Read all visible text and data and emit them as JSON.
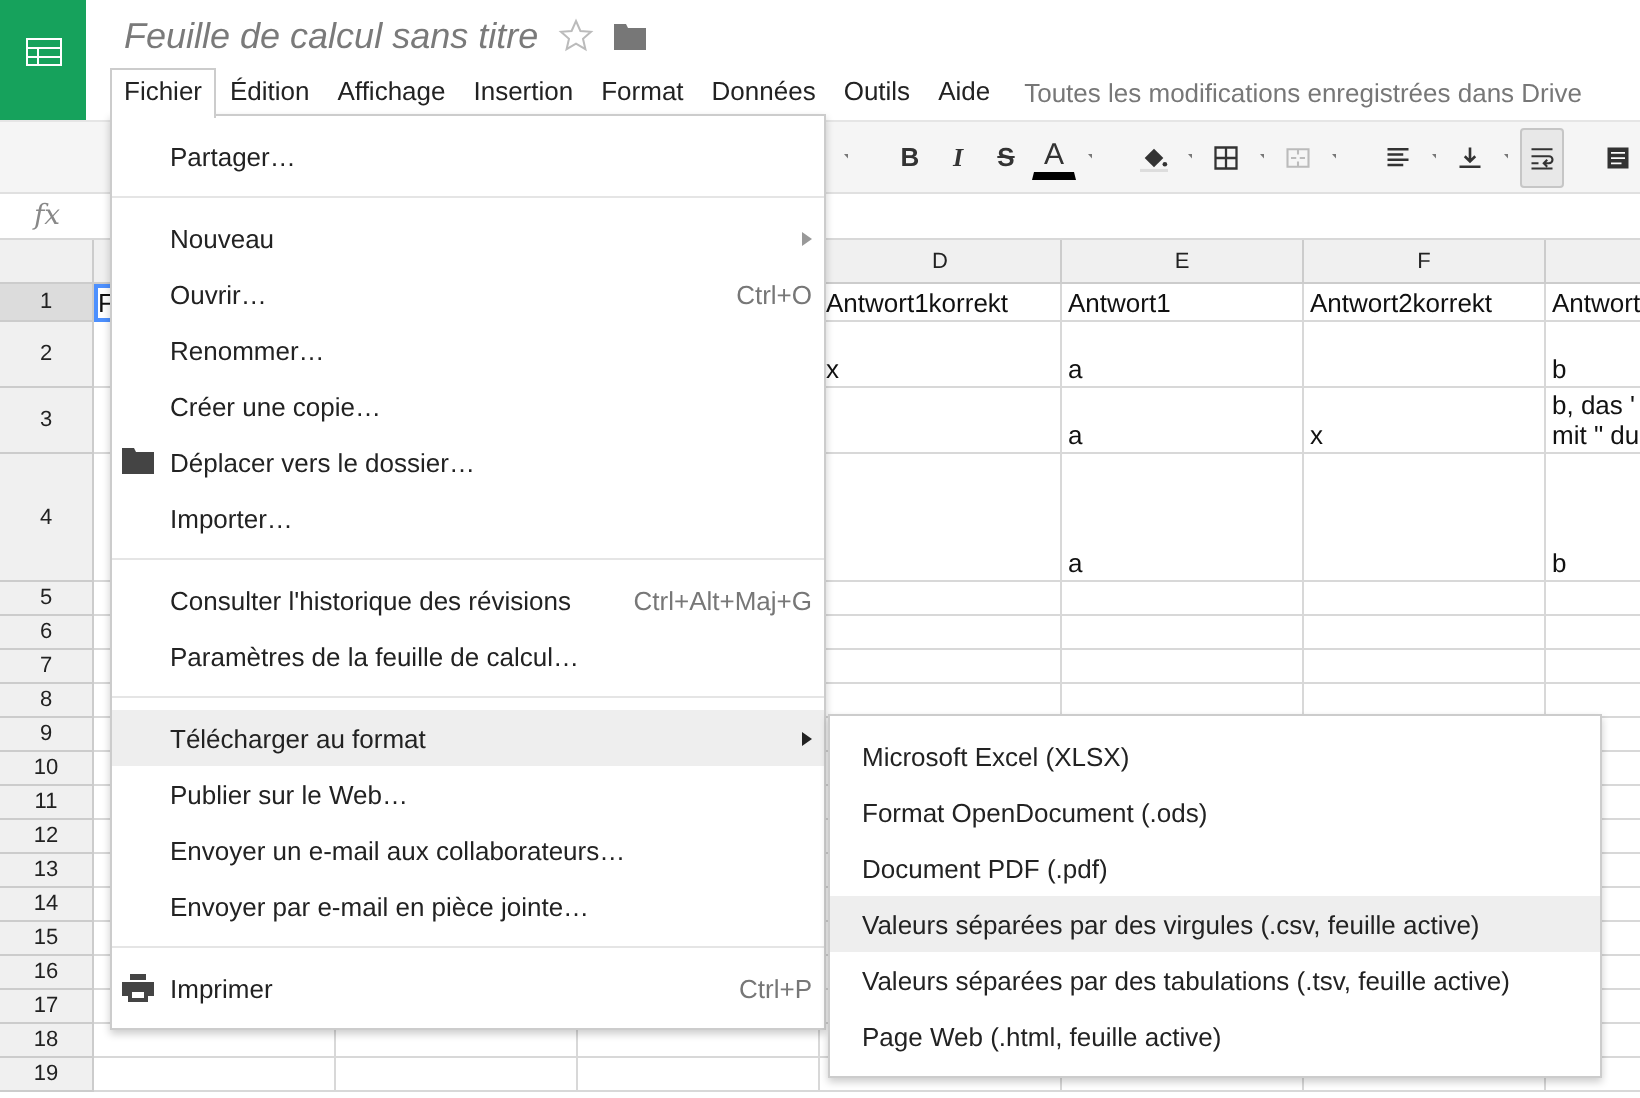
{
  "document": {
    "title": "Feuille de calcul sans titre",
    "starred": false
  },
  "menubar": {
    "items": [
      {
        "label": "Fichier",
        "selected": true
      },
      {
        "label": "Édition",
        "selected": false
      },
      {
        "label": "Affichage",
        "selected": false
      },
      {
        "label": "Insertion",
        "selected": false
      },
      {
        "label": "Format",
        "selected": false
      },
      {
        "label": "Données",
        "selected": false
      },
      {
        "label": "Outils",
        "selected": false
      },
      {
        "label": "Aide",
        "selected": false
      }
    ],
    "status": "Toutes les modifications enregistrées dans Drive"
  },
  "toolbar": [
    {
      "kind": "caret"
    },
    {
      "kind": "separator"
    },
    {
      "kind": "bold",
      "label": "B"
    },
    {
      "kind": "italic",
      "label": "I"
    },
    {
      "kind": "strike",
      "label": "S"
    },
    {
      "kind": "textcolor",
      "label": "A"
    },
    {
      "kind": "caret"
    },
    {
      "kind": "separator"
    },
    {
      "kind": "fill"
    },
    {
      "kind": "caret"
    },
    {
      "kind": "borders"
    },
    {
      "kind": "caret"
    },
    {
      "kind": "merge",
      "disabled": true
    },
    {
      "kind": "caret"
    },
    {
      "kind": "separator"
    },
    {
      "kind": "align"
    },
    {
      "kind": "caret"
    },
    {
      "kind": "valign"
    },
    {
      "kind": "caret"
    },
    {
      "kind": "wrap",
      "selected": true
    },
    {
      "kind": "separator"
    },
    {
      "kind": "comment"
    }
  ],
  "formula_bar": {
    "label": "fx"
  },
  "grid": {
    "columns": [
      "",
      "",
      "",
      "D",
      "E",
      "F",
      ""
    ],
    "rows": [
      {
        "number": "1",
        "selected": true,
        "cells": [
          "F",
          "",
          "",
          "Antwort1korrekt",
          "Antwort1",
          "Antwort2korrekt",
          "Antwort"
        ]
      },
      {
        "number": "2",
        "selected": false,
        "cells": [
          "",
          "",
          "",
          "x",
          "a",
          "",
          "b"
        ]
      },
      {
        "number": "3",
        "selected": false,
        "cells": [
          "",
          "",
          "",
          "",
          "a",
          "x",
          "b, das '\nmit \" du"
        ]
      },
      {
        "number": "4",
        "selected": false,
        "cells": [
          "",
          "",
          "",
          "",
          "a",
          "",
          "b"
        ]
      },
      {
        "number": "5",
        "selected": false,
        "cells": []
      },
      {
        "number": "6",
        "selected": false,
        "cells": []
      },
      {
        "number": "7",
        "selected": false,
        "cells": []
      },
      {
        "number": "8",
        "selected": false,
        "cells": []
      },
      {
        "number": "9",
        "selected": false,
        "cells": []
      },
      {
        "number": "10",
        "selected": false,
        "cells": []
      },
      {
        "number": "11",
        "selected": false,
        "cells": []
      },
      {
        "number": "12",
        "selected": false,
        "cells": []
      },
      {
        "number": "13",
        "selected": false,
        "cells": []
      },
      {
        "number": "14",
        "selected": false,
        "cells": []
      },
      {
        "number": "15",
        "selected": false,
        "cells": []
      },
      {
        "number": "16",
        "selected": false,
        "cells": []
      },
      {
        "number": "17",
        "selected": false,
        "cells": []
      },
      {
        "number": "18",
        "selected": false,
        "cells": []
      },
      {
        "number": "19",
        "selected": false,
        "cells": []
      }
    ]
  },
  "file_menu": {
    "groups": [
      [
        {
          "label": "Partager…",
          "highlighted": false
        }
      ],
      [
        {
          "label": "Nouveau",
          "submenu": true,
          "highlighted": false
        },
        {
          "label": "Ouvrir…",
          "shortcut": "Ctrl+O",
          "highlighted": false
        },
        {
          "label": "Renommer…",
          "highlighted": false
        },
        {
          "label": "Créer une copie…",
          "highlighted": false
        },
        {
          "label": "Déplacer vers le dossier…",
          "kind": "folder",
          "highlighted": false
        },
        {
          "label": "Importer…",
          "highlighted": false
        }
      ],
      [
        {
          "label": "Consulter l'historique des révisions",
          "shortcut": "Ctrl+Alt+Maj+G",
          "highlighted": false
        },
        {
          "label": "Paramètres de la feuille de calcul…",
          "highlighted": false
        }
      ],
      [
        {
          "label": "Télécharger au format",
          "submenu": true,
          "highlighted": true
        },
        {
          "label": "Publier sur le Web…",
          "highlighted": false
        },
        {
          "label": "Envoyer un e-mail aux collaborateurs…",
          "highlighted": false
        },
        {
          "label": "Envoyer par e-mail en pièce jointe…",
          "highlighted": false
        }
      ],
      [
        {
          "label": "Imprimer",
          "shortcut": "Ctrl+P",
          "kind": "printer",
          "highlighted": false
        }
      ]
    ]
  },
  "download_submenu": {
    "items": [
      {
        "label": "Microsoft Excel (XLSX)",
        "highlighted": false
      },
      {
        "label": "Format OpenDocument (.ods)",
        "highlighted": false
      },
      {
        "label": "Document PDF (.pdf)",
        "highlighted": false
      },
      {
        "label": "Valeurs séparées par des virgules (.csv, feuille active)",
        "highlighted": true
      },
      {
        "label": "Valeurs séparées par des tabulations (.tsv, feuille active)",
        "highlighted": false
      },
      {
        "label": "Page Web (.html, feuille active)",
        "highlighted": false
      }
    ]
  }
}
